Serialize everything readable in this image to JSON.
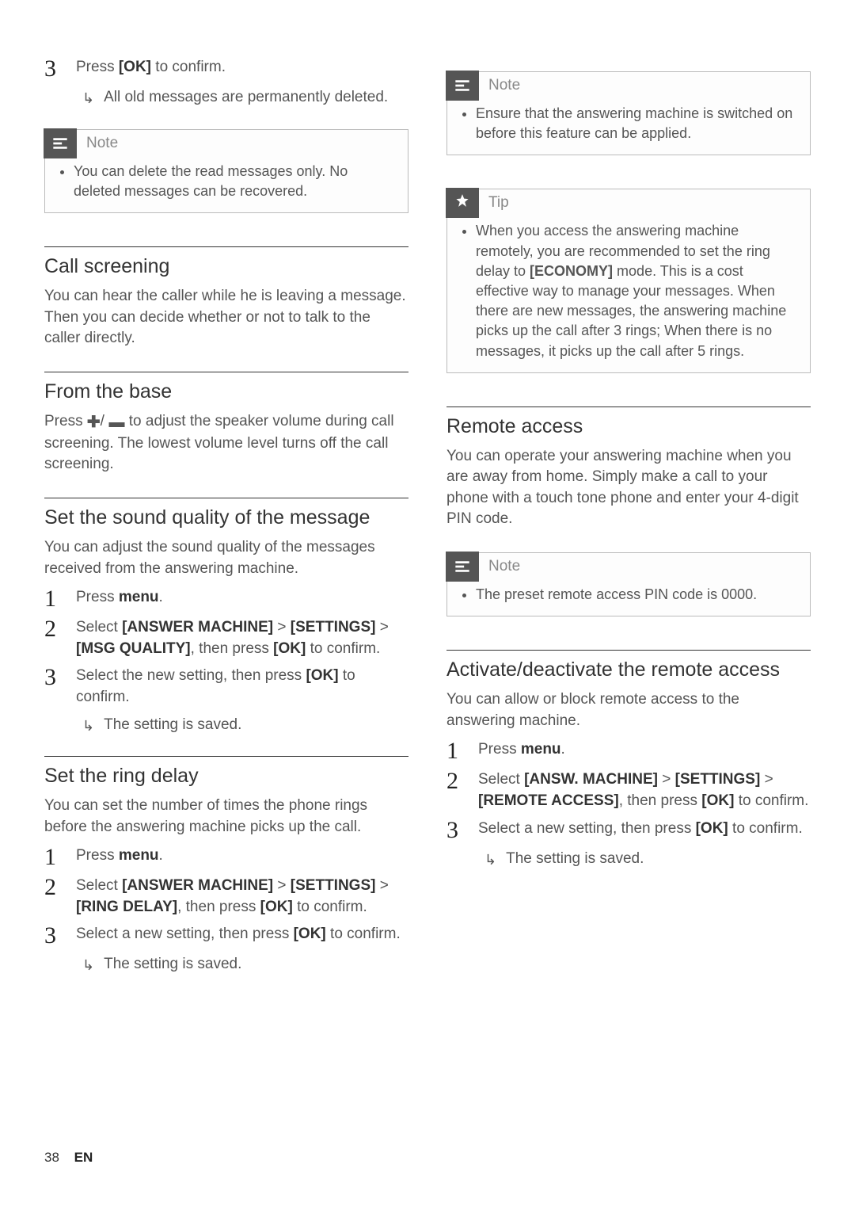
{
  "col1": {
    "step3": {
      "num": "3",
      "text_pre": "Press ",
      "text_bold": "[OK]",
      "text_post": " to confirm.",
      "result": "All old messages are permanently deleted."
    },
    "note1": {
      "title": "Note",
      "item": "You can delete the read messages only. No deleted messages can be recovered."
    },
    "call_screening": {
      "heading": "Call screening",
      "para": "You can hear the caller while he is leaving a message. Then you can decide whether or not to talk to the caller directly."
    },
    "from_base": {
      "heading": "From the base",
      "para_pre": "Press ",
      "para_post": " to adjust the speaker volume during call screening. The lowest volume level turns off the call screening."
    },
    "sound_quality": {
      "heading": "Set the sound quality of the message",
      "para": "You can adjust the sound quality of the messages received from the answering machine.",
      "s1": {
        "num": "1",
        "pre": "Press ",
        "bold": "menu",
        "post": "."
      },
      "s2": {
        "num": "2",
        "pre": "Select ",
        "b1": "[ANSWER MACHINE]",
        "gt1": " > ",
        "b2": "[SETTINGS]",
        "gt2": " > ",
        "b3": "[MSG QUALITY]",
        "mid": ", then press ",
        "b4": "[OK]",
        "post": " to confirm."
      },
      "s3": {
        "num": "3",
        "pre": "Select the new setting, then press ",
        "b1": "[OK]",
        "post": " to confirm.",
        "result": "The setting is saved."
      }
    },
    "ring_delay": {
      "heading": "Set the ring delay",
      "para": "You can set the number of times the phone rings before the answering machine picks up the call.",
      "s1": {
        "num": "1",
        "pre": "Press ",
        "bold": "menu",
        "post": "."
      },
      "s2": {
        "num": "2",
        "pre": "Select ",
        "b1": "[ANSWER MACHINE]",
        "gt1": " > ",
        "b2": "[SETTINGS]",
        "gt2": " > ",
        "b3": "[RING DELAY]",
        "mid": ", then press ",
        "b4": "[OK]",
        "post": " to confirm."
      },
      "s3": {
        "num": "3",
        "pre": "Select a new setting, then press ",
        "b1": "[OK]",
        "post": " to confirm.",
        "result": "The setting is saved."
      }
    }
  },
  "col2": {
    "note_switch": {
      "title": "Note",
      "item": "Ensure that the answering machine is switched on before this feature can be applied."
    },
    "tip": {
      "title": "Tip",
      "pre": "When you access the answering machine remotely, you are recommended to set the ring delay to ",
      "bold": "[ECONOMY]",
      "post": " mode. This is a cost effective way to manage your messages. When there are new messages, the answering machine picks up the call after 3 rings; When there is no messages, it picks up the call after 5 rings."
    },
    "remote_access": {
      "heading": "Remote access",
      "para": "You can operate your answering machine when you are away from home. Simply make a call to your phone with a touch tone phone and enter your 4-digit PIN code."
    },
    "note_pin": {
      "title": "Note",
      "item": "The preset remote access PIN code is 0000."
    },
    "activate": {
      "heading": "Activate/deactivate the remote access",
      "para": "You can allow or block remote access to the answering machine.",
      "s1": {
        "num": "1",
        "pre": "Press ",
        "bold": "menu",
        "post": "."
      },
      "s2": {
        "num": "2",
        "pre": "Select ",
        "b1": "[ANSW. MACHINE]",
        "gt1": " > ",
        "b2": "[SETTINGS]",
        "gt2": " > ",
        "b3": "[REMOTE ACCESS]",
        "mid": ", then press ",
        "b4": "[OK]",
        "post": " to confirm."
      },
      "s3": {
        "num": "3",
        "pre": "Select a new setting, then press ",
        "b1": "[OK]",
        "post": " to confirm.",
        "result": "The setting is saved."
      }
    }
  },
  "footer": {
    "page": "38",
    "lang": "EN"
  }
}
